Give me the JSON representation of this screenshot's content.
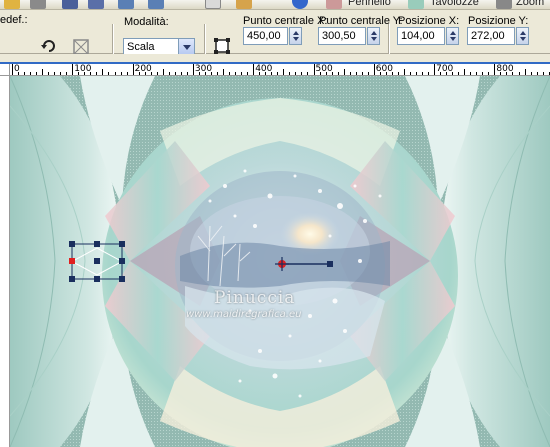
{
  "toolbar": {
    "items": [
      {
        "icon": "folder-icon"
      },
      {
        "icon": "eraser-icon"
      },
      {
        "icon": "save-icon"
      },
      {
        "icon": "save-as-icon"
      },
      {
        "icon": "undo-icon"
      },
      {
        "icon": "redo-icon"
      },
      {
        "icon": "copy-icon"
      },
      {
        "icon": "paste-icon"
      },
      {
        "icon": "help-icon"
      }
    ],
    "labels": [
      "Pennello",
      "Tavolozze",
      "Zoom"
    ]
  },
  "options": {
    "preset_label": "edef.:",
    "mode_label": "Modalità:",
    "mode_value": "Scala",
    "center_x_label": "Punto centrale X:",
    "center_x_value": "450,00",
    "center_y_label": "Punto centrale Y:",
    "center_y_value": "300,50",
    "pos_x_label": "Posizione X:",
    "pos_x_value": "104,00",
    "pos_y_label": "Posizione Y:",
    "pos_y_value": "272,00"
  },
  "ruler": {
    "labels": [
      "0",
      "100",
      "200",
      "300",
      "400",
      "500",
      "600",
      "700",
      "800"
    ]
  },
  "canvas": {
    "watermark_name": "Pinuccia",
    "watermark_url": "www.maidiregrafica.eu",
    "colors": {
      "background": "#9fc3bb",
      "sphere_light": "#e6f6f3",
      "handle_blue": "#1a2f5e",
      "handle_red": "#e02020"
    }
  }
}
